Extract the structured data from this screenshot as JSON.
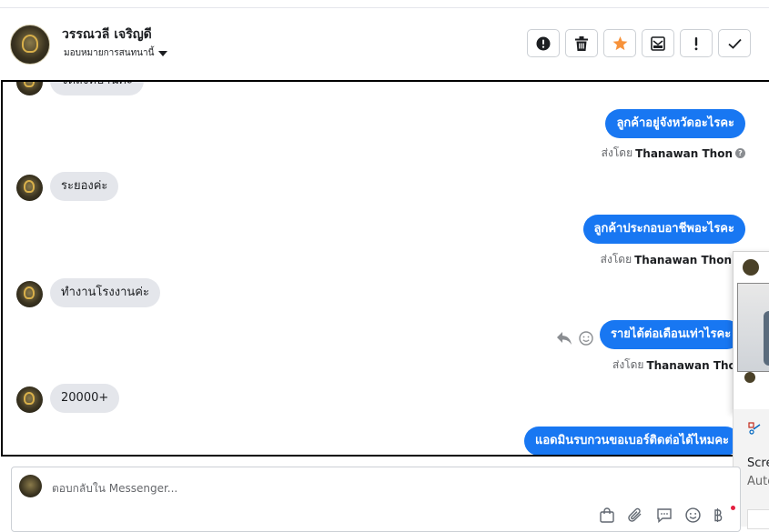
{
  "header": {
    "contact_name": "วรรณวลี เจริญดี",
    "assign_label": "มอบหมายการสนทนานี้",
    "actions": [
      {
        "name": "mark-spam-button",
        "icon": "alert-circle-icon"
      },
      {
        "name": "delete-button",
        "icon": "trash-icon"
      },
      {
        "name": "star-button",
        "icon": "star-icon"
      },
      {
        "name": "mark-unread-button",
        "icon": "envelope-icon"
      },
      {
        "name": "follow-up-button",
        "icon": "exclamation-icon"
      },
      {
        "name": "mark-done-button",
        "icon": "checkmark-icon"
      }
    ]
  },
  "conversation": {
    "messages": [
      {
        "direction": "in",
        "text": "จัดส่งที่บ้านค่ะ"
      },
      {
        "direction": "out",
        "text": "ลูกค้าอยู่จังหวัดอะไรคะ",
        "sent_by_label": "ส่งโดย",
        "sender": "Thanawan Thon"
      },
      {
        "direction": "in",
        "text": "ระยองค่ะ"
      },
      {
        "direction": "out",
        "text": "ลูกค้าประกอบอาชีพอะไรคะ",
        "sent_by_label": "ส่งโดย",
        "sender": "Thanawan Thon"
      },
      {
        "direction": "in",
        "text": "ทำงานโรงงานค่ะ"
      },
      {
        "direction": "out",
        "text": "รายได้ต่อเดือนเท่าไรคะ",
        "sent_by_label": "ส่งโดย",
        "sender": "Thanawan Thon"
      },
      {
        "direction": "in",
        "text": "20000+"
      },
      {
        "direction": "out",
        "text": "แอดมินรบกวนขอเบอร์ติดต่อได้ไหมคะ"
      }
    ]
  },
  "overlay": {
    "snip_title": "Scre",
    "snip_subtitle": "Auto"
  },
  "composer": {
    "placeholder": "ตอบกลับใน Messenger..."
  },
  "colors": {
    "accent": "#1877f2",
    "incoming_bubble": "#e4e6eb",
    "star": "#f7923a"
  }
}
